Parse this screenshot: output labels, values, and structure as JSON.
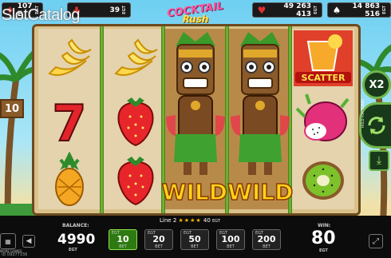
{
  "watermark": "SlotCatalog",
  "game_title": {
    "line1": "COCKTAIL",
    "line2": "Rush"
  },
  "top_stats": [
    {
      "icon": "diamond-icon",
      "value": "107 E",
      "egt": "EGT"
    },
    {
      "icon": "club-icon",
      "value": "39",
      "egt": "EGT"
    },
    {
      "icon": "heart-icon",
      "value": "49 263 413",
      "egt": "EGT"
    },
    {
      "icon": "spade-icon",
      "value": "14 863 516",
      "egt": "EGT"
    }
  ],
  "side_sign": "10",
  "side_buttons": {
    "multiplier": "X2",
    "hold_label": "HOLD FOR TURBO"
  },
  "symbols": {
    "scatter_label": "SCATTER",
    "wild_label": "WILDWILD",
    "seven": "7"
  },
  "bottom": {
    "line_text": "Line 2",
    "line_win": "40",
    "line_unit": "EGT",
    "balance_label": "BALANCE:",
    "balance_value": "4990",
    "balance_unit": "EGT",
    "win_label": "WIN:",
    "win_value": "80",
    "win_unit": "EGT",
    "bets": [
      {
        "egt": "EGT",
        "value": "10",
        "bet": "BET",
        "selected": true
      },
      {
        "egt": "EGT",
        "value": "20",
        "bet": "BET",
        "selected": false
      },
      {
        "egt": "EGT",
        "value": "50",
        "bet": "BET",
        "selected": false
      },
      {
        "egt": "EGT",
        "value": "100",
        "bet": "BET",
        "selected": false
      },
      {
        "egt": "EGT",
        "value": "200",
        "bet": "BET",
        "selected": false
      }
    ],
    "more_games": "MORE GAMES",
    "id_text": "ID 09377156"
  },
  "colors": {
    "accent_green": "#6fb64a",
    "bet_selected": "#2d7a10",
    "star": "#f6b600"
  }
}
